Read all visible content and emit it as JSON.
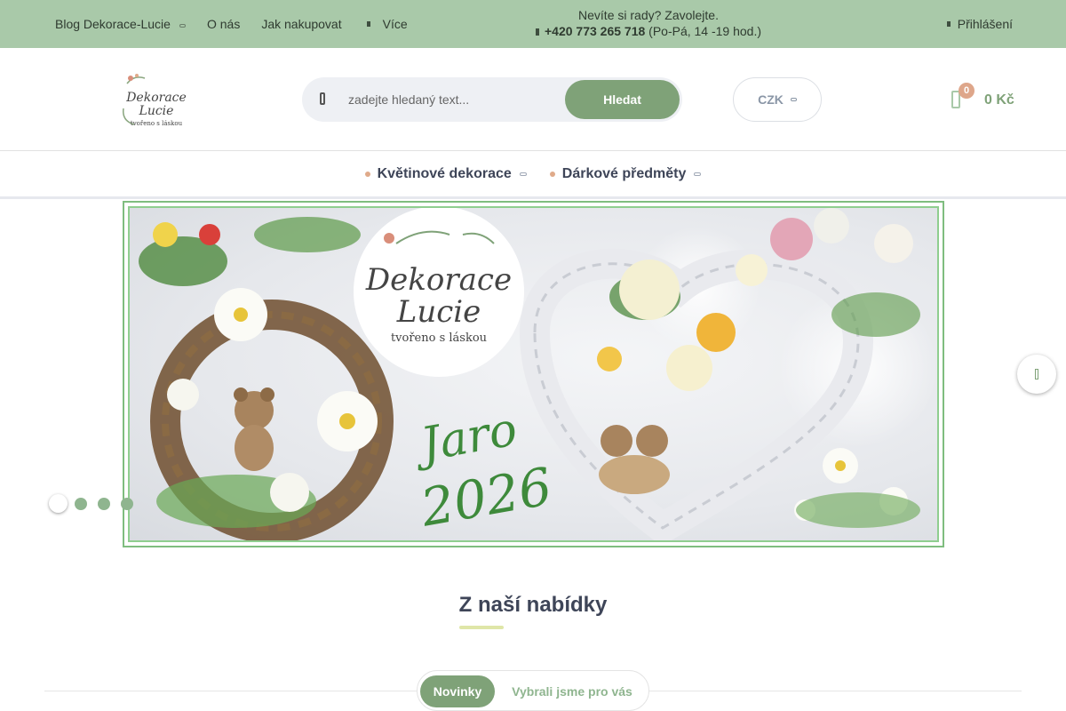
{
  "topbar": {
    "nav": [
      {
        "label": "Blog Dekorace-Lucie",
        "has_dropdown": true
      },
      {
        "label": "O nás"
      },
      {
        "label": "Jak nakupovat"
      },
      {
        "label": "Více",
        "icon": "chevron-down-icon"
      }
    ],
    "contact_line1": "Nevíte si rady? Zavolejte.",
    "phone": "+420 773 265 718",
    "hours": "(Po-Pá, 14 -19 hod.)",
    "login_label": "Přihlášení"
  },
  "header": {
    "logo_name": "Dekorace",
    "logo_name2": "Lucie",
    "logo_tagline": "tvořeno s láskou",
    "search_placeholder": "zadejte hledaný text...",
    "search_button": "Hledat",
    "currency": "CZK",
    "cart_count": "0",
    "cart_total": "0 Kč"
  },
  "categories": [
    {
      "label": "Květinové dekorace"
    },
    {
      "label": "Dárkové předměty"
    }
  ],
  "banner": {
    "logo_line1": "Dekorace",
    "logo_line2": "Lucie",
    "logo_tagline": "tvořeno s láskou",
    "headline1": "Jaro",
    "headline2": "2026",
    "slides": 4,
    "active_slide": 1
  },
  "section": {
    "title": "Z naší nabídky",
    "tabs": [
      {
        "label": "Novinky",
        "active": true
      },
      {
        "label": "Vybrali jsme pro vás",
        "active": false
      }
    ]
  },
  "colors": {
    "topbar_bg": "#a9c9a9",
    "accent_green": "#7fa278",
    "badge_peach": "#dea68a",
    "heading_text": "#3e4558"
  }
}
